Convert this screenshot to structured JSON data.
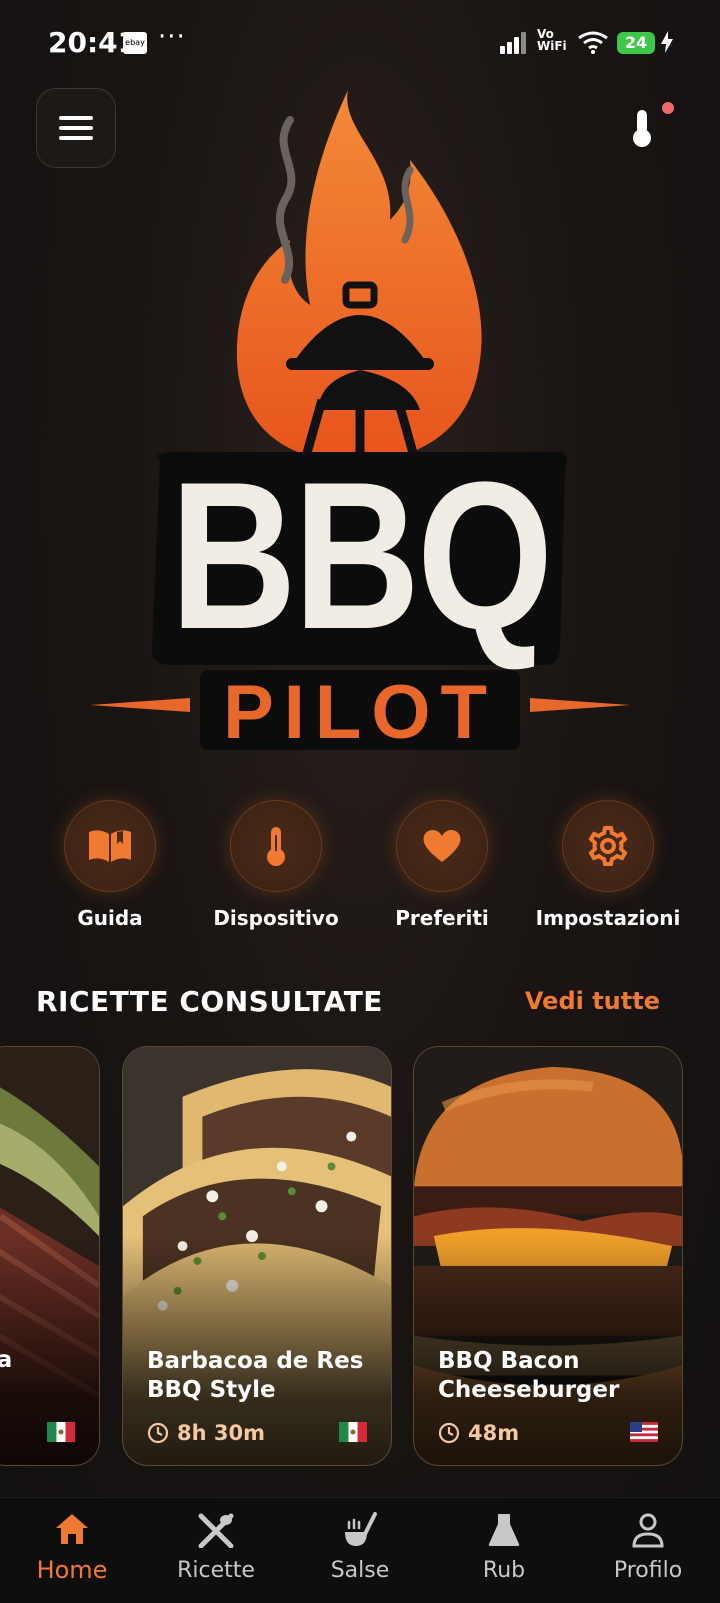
{
  "status_bar": {
    "time": "20:41",
    "ebay": "ebay",
    "dots": "···",
    "network_label_top": "Vo",
    "network_label_bottom": "WiFi",
    "battery": "24"
  },
  "header": {
    "notification": true
  },
  "logo": {
    "title": "BBQ",
    "subtitle": "PILOT"
  },
  "quick_actions": [
    {
      "label": "Guida",
      "icon": "book-icon"
    },
    {
      "label": "Dispositivo",
      "icon": "thermometer-icon"
    },
    {
      "label": "Preferiti",
      "icon": "heart-icon"
    },
    {
      "label": "Impostazioni",
      "icon": "gear-icon"
    }
  ],
  "recent": {
    "title": "RICETTE CONSULTATE",
    "see_all": "Vedi tutte",
    "cards": [
      {
        "title_fragment": "lla",
        "flag": "mexico-flag"
      },
      {
        "title_line1": "Barbacoa de Res",
        "title_line2": "BBQ Style",
        "time": "8h 30m",
        "flag": "mexico-flag"
      },
      {
        "title_line1": "BBQ Bacon",
        "title_line2": "Cheeseburger",
        "time": "48m",
        "flag": "usa-flag"
      }
    ]
  },
  "nav": {
    "items": [
      {
        "label": "Home",
        "icon": "home-icon",
        "active": true
      },
      {
        "label": "Ricette",
        "icon": "utensils-icon"
      },
      {
        "label": "Salse",
        "icon": "sauce-icon"
      },
      {
        "label": "Rub",
        "icon": "flask-icon"
      },
      {
        "label": "Profilo",
        "icon": "user-icon"
      }
    ]
  },
  "colors": {
    "accent": "#f07a32",
    "background": "#161312",
    "logo_text": "#f2ede4"
  }
}
